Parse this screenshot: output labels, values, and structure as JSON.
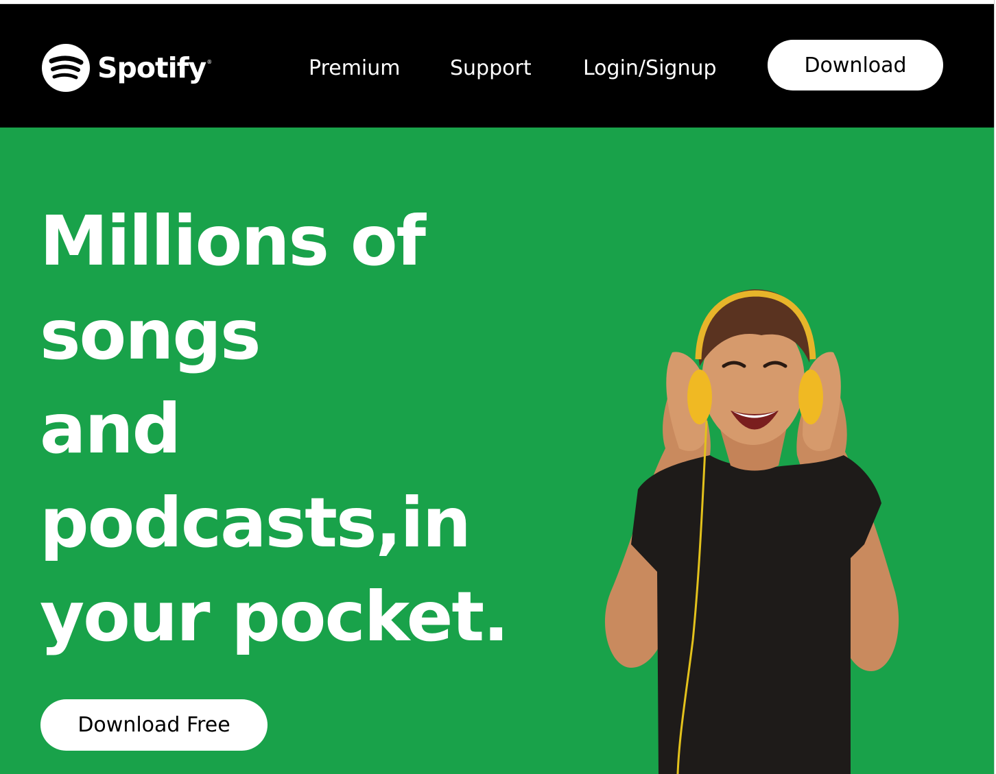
{
  "navbar": {
    "brand": "Spotify",
    "brand_mark": "®",
    "links": [
      {
        "label": "Premium"
      },
      {
        "label": "Support"
      },
      {
        "label": "Login/Signup"
      }
    ],
    "download_label": "Download"
  },
  "hero": {
    "headline": "Millions of\nsongs\nand\npodcasts,in\nyour pocket.",
    "cta_label": "Download Free",
    "image": "man-with-yellow-headphones"
  },
  "colors": {
    "navbar_bg": "#000000",
    "hero_bg": "#19a24a",
    "text": "#ffffff",
    "button_bg": "#ffffff",
    "button_text": "#000000"
  },
  "icons": {
    "logo": "spotify-logo-icon"
  }
}
